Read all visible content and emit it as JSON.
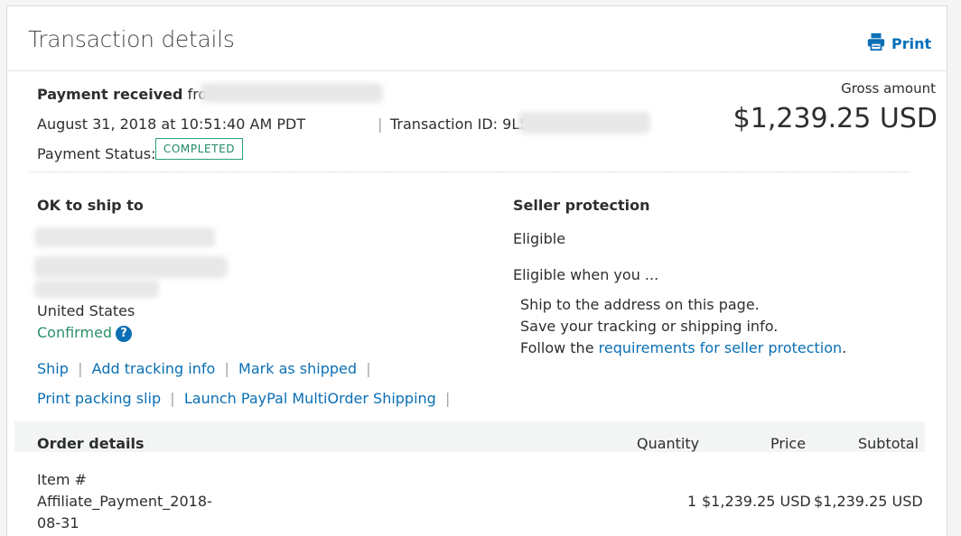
{
  "header": {
    "title": "Transaction details",
    "print_label": "Print"
  },
  "payment": {
    "received_label": "Payment received",
    "from_label": "from",
    "date": "August 31, 2018 at 10:51:40 AM PDT",
    "transaction_id_label": "Transaction ID: 9L5",
    "status_label": "Payment Status:",
    "status_value": "COMPLETED",
    "gross_label": "Gross amount",
    "gross_amount": "$1,239.25 USD"
  },
  "shipping": {
    "heading": "OK to ship to",
    "country": "United States",
    "confirmed": "Confirmed",
    "help_icon": "?",
    "actions_row1": [
      "Ship",
      "Add tracking info",
      "Mark as shipped"
    ],
    "actions_row2": [
      "Print packing slip",
      "Launch PayPal MultiOrder Shipping"
    ]
  },
  "protection": {
    "heading": "Seller protection",
    "status": "Eligible",
    "when_label": "Eligible when you ...",
    "line1": "Ship to the address on this page.",
    "line2": "Save your tracking or shipping info.",
    "line3_prefix": "Follow the",
    "line3_link": "requirements for seller protection",
    "line3_suffix": "."
  },
  "order": {
    "heading": "Order details",
    "columns": {
      "quantity": "Quantity",
      "price": "Price",
      "subtotal": "Subtotal"
    },
    "item": {
      "label": "Item #",
      "name_line1": "Affiliate_Payment_2018-",
      "name_line2": "08-31",
      "quantity": "1",
      "price": "$1,239.25 USD",
      "subtotal": "$1,239.25 USD"
    }
  },
  "colors": {
    "link": "#0a6fb4",
    "badge": "#2aa179"
  },
  "icons": {
    "print": "printer-icon",
    "help": "question-circle-icon"
  }
}
